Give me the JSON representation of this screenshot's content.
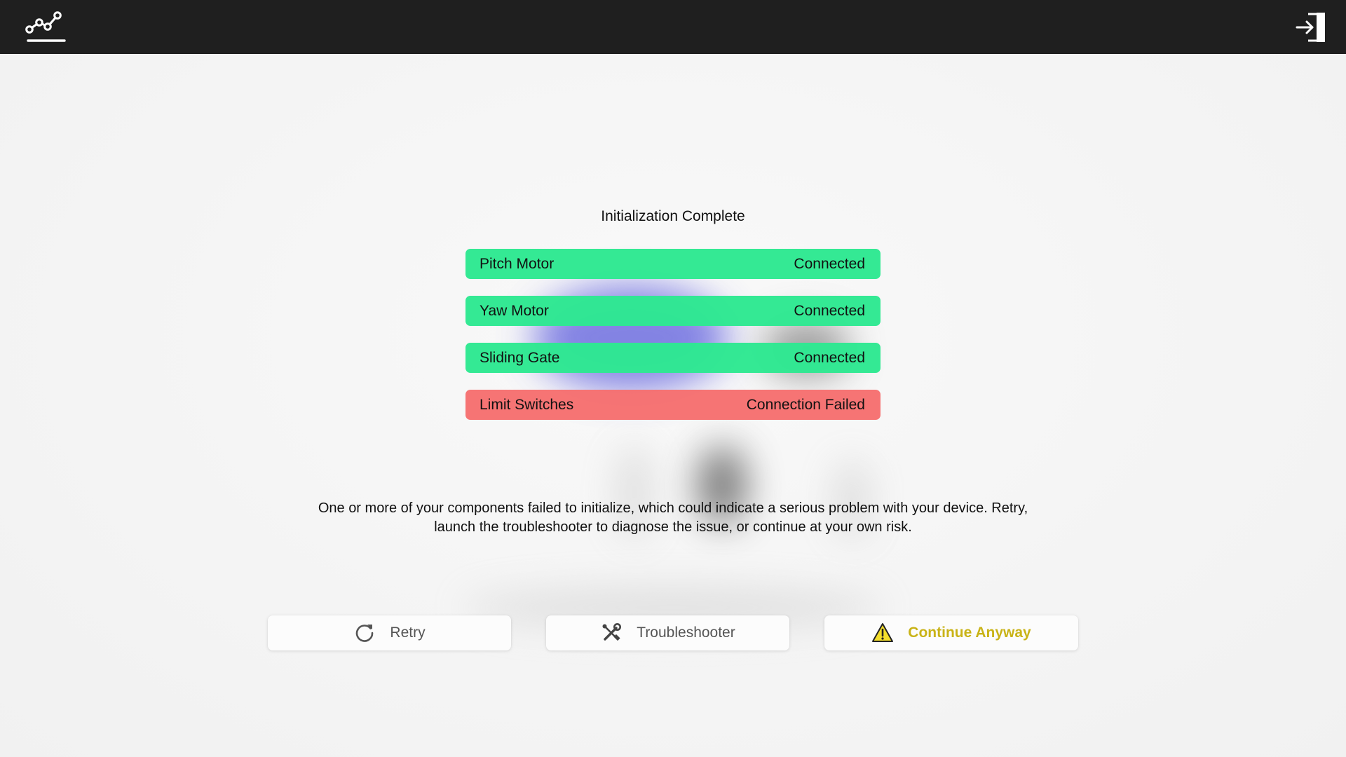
{
  "topbar": {
    "logo_icon": "chart-line-icon",
    "exit_icon": "exit-door-icon",
    "background": "#1f1f1f"
  },
  "init": {
    "title": "Initialization Complete",
    "components": [
      {
        "name": "Pitch Motor",
        "status": "Connected",
        "state": "ok"
      },
      {
        "name": "Yaw Motor",
        "status": "Connected",
        "state": "ok"
      },
      {
        "name": "Sliding Gate",
        "status": "Connected",
        "state": "ok"
      },
      {
        "name": "Limit Switches",
        "status": "Connection Failed",
        "state": "fail"
      }
    ],
    "message_line1": "One or more of your components failed to initialize, which could indicate a serious problem with your device. Retry,",
    "message_line2": "launch the troubleshooter to diagnose the issue, or continue at your own risk."
  },
  "actions": {
    "retry_label": "Retry",
    "retry_icon": "refresh-icon",
    "troubleshoot_label": "Troubleshooter",
    "troubleshoot_icon": "tools-icon",
    "continue_label": "Continue Anyway",
    "continue_icon": "warning-icon",
    "continue_color": "#c9b317"
  },
  "colors": {
    "connected": "#2de891",
    "failed": "#f67070",
    "warning_fill": "#f3de2c"
  }
}
